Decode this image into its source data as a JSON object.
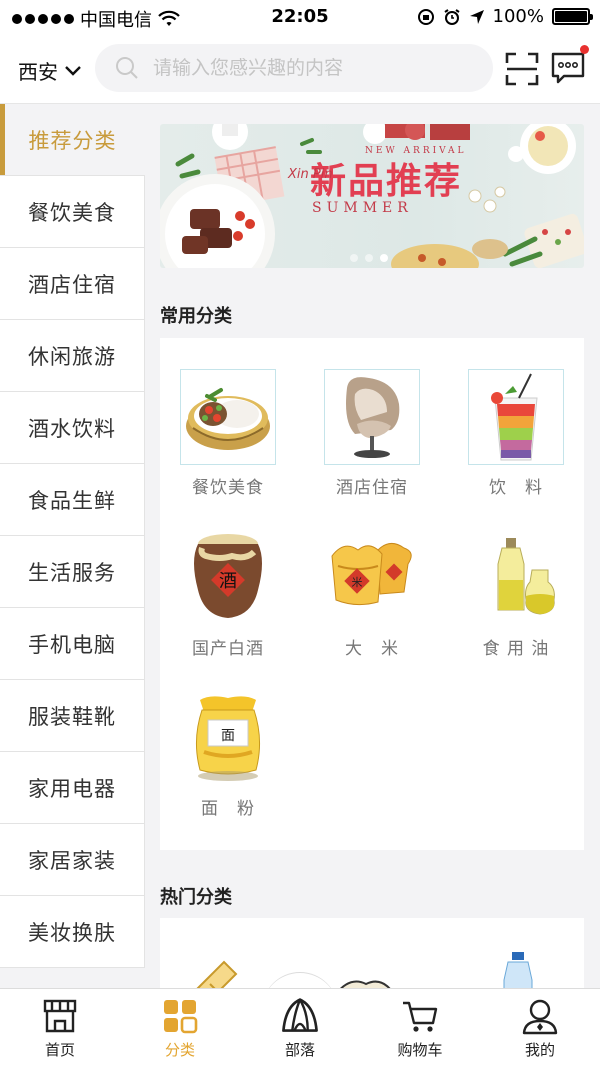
{
  "status_bar": {
    "carrier": "中国电信",
    "time": "22:05",
    "battery": "100%",
    "battery_level": 1.0
  },
  "header": {
    "city": "西安",
    "search_placeholder": "请输入您感兴趣的内容"
  },
  "sidebar": {
    "items": [
      {
        "label": "推荐分类",
        "active": true
      },
      {
        "label": "餐饮美食"
      },
      {
        "label": "酒店住宿"
      },
      {
        "label": "休闲旅游"
      },
      {
        "label": "酒水饮料"
      },
      {
        "label": "食品生鲜"
      },
      {
        "label": "生活服务"
      },
      {
        "label": "手机电脑"
      },
      {
        "label": "服装鞋靴"
      },
      {
        "label": "家用电器"
      },
      {
        "label": "家居家装"
      },
      {
        "label": "美妆换肤"
      }
    ]
  },
  "banner": {
    "title": "新品推荐",
    "subtitle": "NEW ARRIVAL",
    "tag": "Xin Pin",
    "summer": "SUMMER",
    "slides": 3,
    "current_slide": 3
  },
  "common": {
    "title": "常用分类",
    "items": [
      {
        "label": "餐饮美食",
        "icon": "food-bowl-icon"
      },
      {
        "label": "酒店住宿",
        "icon": "egg-chair-icon"
      },
      {
        "label": "饮　料",
        "icon": "drink-glass-icon"
      },
      {
        "label": "国产白酒",
        "icon": "liquor-jar-icon"
      },
      {
        "label": "大　米",
        "icon": "rice-bag-icon"
      },
      {
        "label": "食 用 油",
        "icon": "oil-bottle-icon"
      },
      {
        "label": "面　粉",
        "icon": "flour-bag-icon"
      }
    ]
  },
  "hot": {
    "title": "热门分类"
  },
  "tabbar": {
    "items": [
      {
        "label": "首页",
        "icon": "store-icon"
      },
      {
        "label": "分类",
        "icon": "grid-icon",
        "active": true
      },
      {
        "label": "部落",
        "icon": "tent-icon"
      },
      {
        "label": "购物车",
        "icon": "cart-icon"
      },
      {
        "label": "我的",
        "icon": "user-icon"
      }
    ]
  },
  "colors": {
    "accent": "#c89b3c",
    "tab_active": "#e3a531",
    "badge": "#e8312f"
  }
}
